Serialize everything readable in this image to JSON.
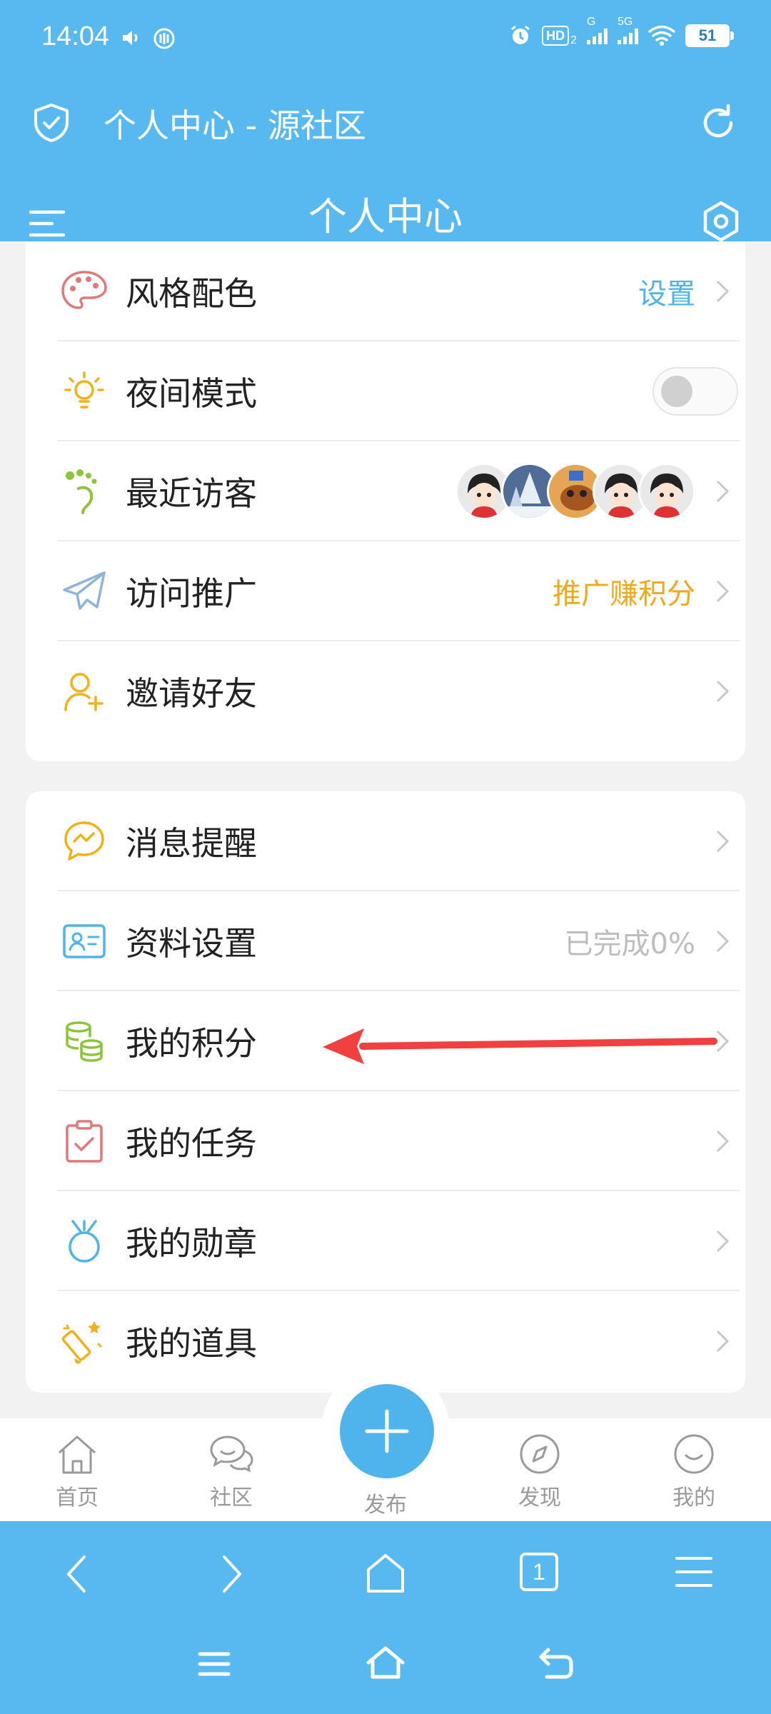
{
  "status": {
    "time": "14:04",
    "hd_badge": "HD",
    "hd_sub": "2",
    "net1": "G",
    "net2": "5G",
    "battery": "51"
  },
  "header": {
    "web_title": "个人中心 - 源社区",
    "page_title": "个人中心"
  },
  "section1": {
    "items": [
      {
        "label": "风格配色",
        "value": "设置",
        "value_color": "#4fb4ec",
        "icon": "palette-icon"
      },
      {
        "label": "夜间模式",
        "toggle": "off",
        "icon": "lightbulb-icon"
      },
      {
        "label": "最近访客",
        "avatars": 5,
        "icon": "footprint-icon"
      },
      {
        "label": "访问推广",
        "value": "推广赚积分",
        "value_color": "#f0a81c",
        "icon": "paper-plane-icon"
      },
      {
        "label": "邀请好友",
        "icon": "add-user-icon"
      }
    ]
  },
  "section2": {
    "items": [
      {
        "label": "消息提醒",
        "icon": "message-icon"
      },
      {
        "label": "资料设置",
        "value": "已完成0%",
        "value_color": "#bdbdbd",
        "icon": "profile-card-icon"
      },
      {
        "label": "我的积分",
        "icon": "coins-icon"
      },
      {
        "label": "我的任务",
        "icon": "clipboard-icon"
      },
      {
        "label": "我的勋章",
        "icon": "medal-icon"
      },
      {
        "label": "我的道具",
        "icon": "magic-wand-icon"
      }
    ]
  },
  "bottom_nav": {
    "home": "首页",
    "community": "社区",
    "publish": "发布",
    "discover": "发现",
    "mine": "我的"
  },
  "browser": {
    "tab_count": "1"
  },
  "colors": {
    "brand": "#58b9f0",
    "annotation_arrow": "#f04040"
  }
}
